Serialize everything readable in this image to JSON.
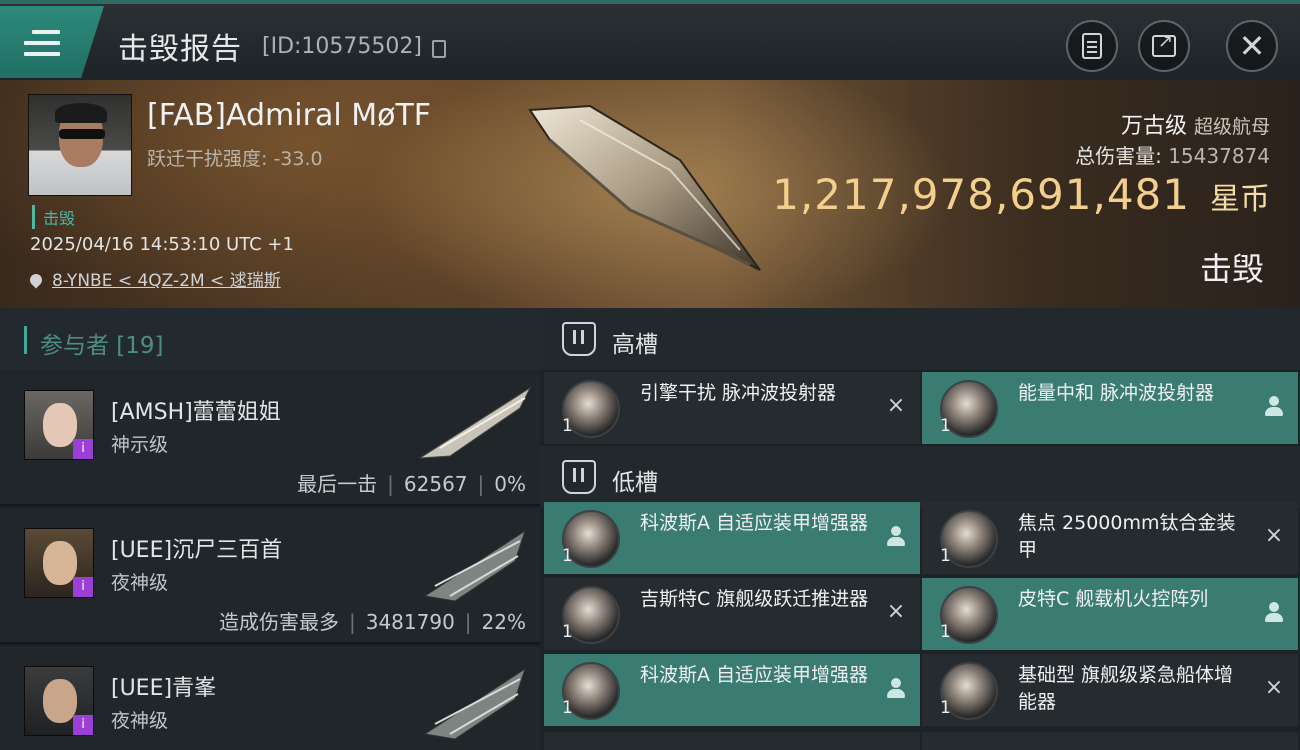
{
  "header": {
    "title": "击毁报告",
    "id_text": "[ID:10575502]",
    "icons": [
      "menu-icon",
      "copy-icon",
      "report-icon",
      "share-icon",
      "close-icon"
    ]
  },
  "victim": {
    "name": "[FAB]Admiral MøTF",
    "warp_text": "跃迁干扰强度: -33.0",
    "kill_tag": "击毁",
    "timestamp": "2025/04/16 14:53:10 UTC +1",
    "location": "8-YNBE < 4QZ-2M < 逑瑞斯",
    "ship_name": "万古级",
    "ship_type": "超级航母",
    "damage_label": "总伤害量:",
    "damage_value": "15437874",
    "isk_value": "1,217,978,691,481",
    "isk_unit": "星币",
    "result": "击毁"
  },
  "participants": {
    "header": "参与者 [19]",
    "rows": [
      {
        "name": "[AMSH]蕾蕾姐姐",
        "ship": "神示级",
        "tag": "最后一击",
        "damage": "62567",
        "percent": "0%"
      },
      {
        "name": "[UEE]沉尸三百首",
        "ship": "夜神级",
        "tag": "造成伤害最多",
        "damage": "3481790",
        "percent": "22%"
      },
      {
        "name": "[UEE]青峯",
        "ship": "夜神级",
        "tag": "",
        "damage": "",
        "percent": ""
      }
    ]
  },
  "slots": {
    "high": {
      "label": "高槽",
      "items": [
        {
          "name": "引擎干扰 脉冲波投射器",
          "qty": "1",
          "action": "×"
        },
        {
          "name": "能量中和 脉冲波投射器",
          "qty": "1",
          "action": "person-icon"
        }
      ]
    },
    "low": {
      "label": "低槽",
      "items": [
        {
          "name": "科波斯A 自适应装甲增强器",
          "qty": "1",
          "action": "person-icon"
        },
        {
          "name": "焦点 25000mm钛合金装甲",
          "qty": "1",
          "action": "×"
        },
        {
          "name": "吉斯特C 旗舰级跃迁推进器",
          "qty": "1",
          "action": "×"
        },
        {
          "name": "皮特C 舰载机火控阵列",
          "qty": "1",
          "action": "person-icon"
        },
        {
          "name": "科波斯A 自适应装甲增强器",
          "qty": "1",
          "action": "person-icon"
        },
        {
          "name": "基础型 旗舰级紧急船体增能器",
          "qty": "1",
          "action": "×"
        }
      ]
    }
  }
}
